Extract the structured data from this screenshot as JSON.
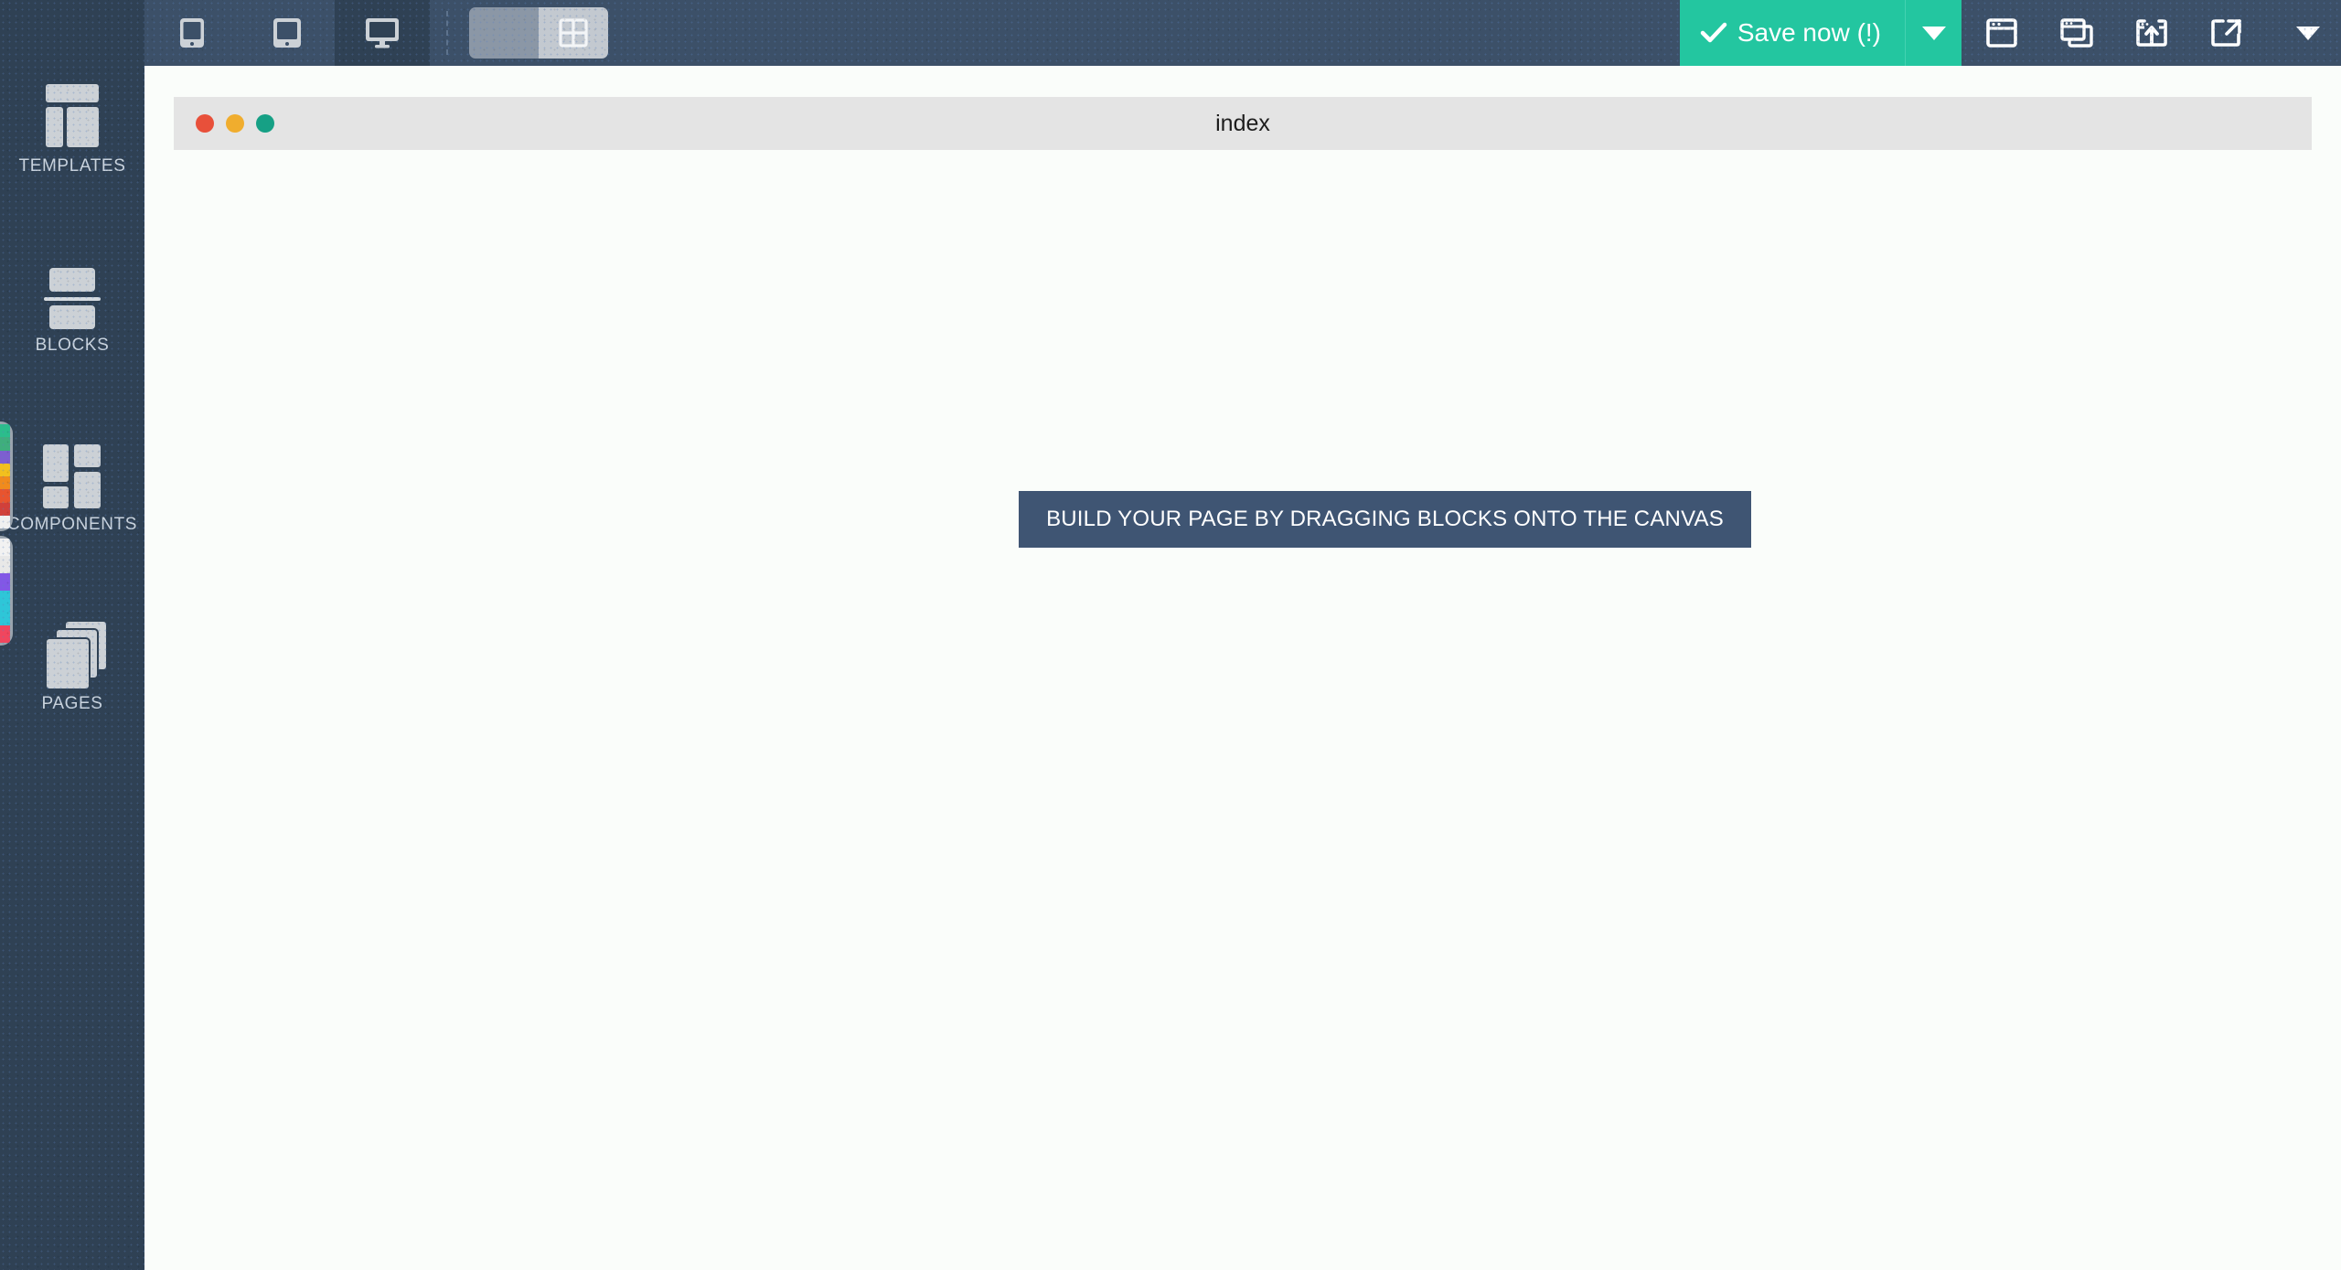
{
  "toolbar": {
    "devices": [
      {
        "name": "mobile",
        "icon": "mobile-phone-icon",
        "active": false
      },
      {
        "name": "tablet",
        "icon": "tablet-icon",
        "active": false
      },
      {
        "name": "desktop",
        "icon": "desktop-monitor-icon",
        "active": true
      }
    ],
    "view_toggle": {
      "left_icon": "list-view-icon",
      "right_icon": "grid-view-icon",
      "selected": "grid"
    },
    "save_label": "Save now (!)",
    "save_icon": "checkmark-icon",
    "save_caret_icon": "chevron-down-icon",
    "accent_color": "#23c6a0",
    "actions": [
      {
        "name": "new-window",
        "icon": "browser-window-icon"
      },
      {
        "name": "duplicate-page",
        "icon": "copy-windows-icon"
      },
      {
        "name": "publish",
        "icon": "upload-box-icon"
      },
      {
        "name": "preview",
        "icon": "external-link-icon"
      }
    ],
    "overflow_icon": "chevron-down-icon"
  },
  "sidebar": {
    "background": "#2f4154",
    "items": [
      {
        "label": "TEMPLATES",
        "icon": "templates-layout-icon"
      },
      {
        "label": "BLOCKS",
        "icon": "blocks-stack-icon"
      },
      {
        "label": "COMPONENTS",
        "icon": "components-grid-icon"
      },
      {
        "label": "PAGES",
        "icon": "pages-stack-icon"
      }
    ],
    "swatches": [
      {
        "name": "color-swatch-1",
        "colors": [
          "#2bbd8c",
          "#3fae7d",
          "#7d5fd0",
          "#f2c01e",
          "#f08b1d",
          "#e8542f",
          "#d1403a",
          "#f0f0f0"
        ]
      },
      {
        "name": "color-swatch-2",
        "colors": [
          "#f2f2f2",
          "#e8e8e8",
          "#8257e6",
          "#2ec6d8",
          "#2ec6d8",
          "#f0465e"
        ]
      }
    ]
  },
  "canvas": {
    "page_title": "index",
    "window_lights": [
      {
        "name": "close-button",
        "color": "#e8503a"
      },
      {
        "name": "minimize-button",
        "color": "#f0ad2e"
      },
      {
        "name": "maximize-button",
        "color": "#16a085"
      }
    ],
    "drop_hint": "BUILD YOUR PAGE BY DRAGGING BLOCKS ONTO THE CANVAS",
    "drop_hint_bg": "#3f5573",
    "background": "#fafdfa"
  }
}
